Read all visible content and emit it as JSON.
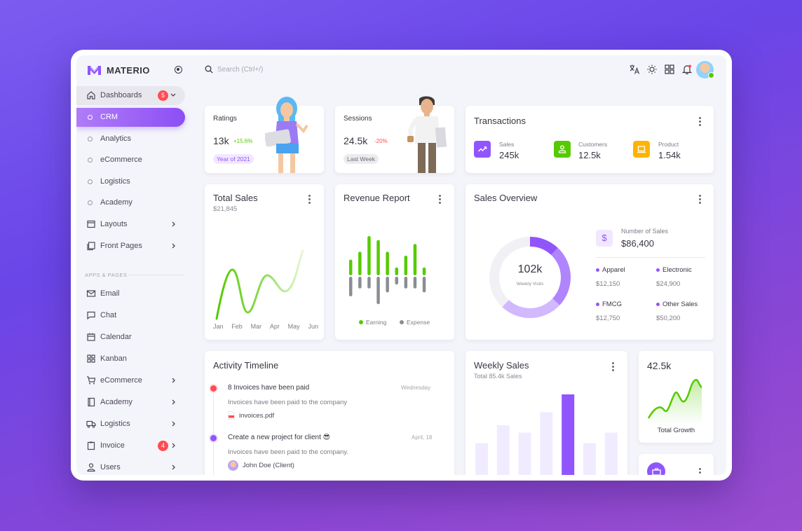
{
  "app": {
    "brand": "MATERIO"
  },
  "search": {
    "placeholder": "Search (Ctrl+/)"
  },
  "sidebar": {
    "dashboards": {
      "label": "Dashboards",
      "badge": "5"
    },
    "sub_items": [
      "CRM",
      "Analytics",
      "eCommerce",
      "Logistics",
      "Academy"
    ],
    "layouts": "Layouts",
    "front_pages": "Front Pages",
    "section": "APPS & PAGES",
    "apps": [
      {
        "label": "Email",
        "icon": "mail-icon"
      },
      {
        "label": "Chat",
        "icon": "chat-icon"
      },
      {
        "label": "Calendar",
        "icon": "calendar-icon"
      },
      {
        "label": "Kanban",
        "icon": "kanban-icon"
      },
      {
        "label": "eCommerce",
        "icon": "cart-icon"
      },
      {
        "label": "Academy",
        "icon": "book-icon"
      },
      {
        "label": "Logistics",
        "icon": "truck-icon"
      },
      {
        "label": "Invoice",
        "icon": "clipboard-icon",
        "badge": "4"
      },
      {
        "label": "Users",
        "icon": "user-icon"
      }
    ]
  },
  "ratings": {
    "title": "Ratings",
    "value": "13k",
    "change": "+15.6%",
    "tag": "Year of 2021"
  },
  "sessions": {
    "title": "Sessions",
    "value": "24.5k",
    "change": "-20%",
    "tag": "Last Week"
  },
  "transactions": {
    "title": "Transactions",
    "stats": [
      {
        "label": "Sales",
        "value": "245k",
        "color": "#9155fd",
        "icon": "trend-icon"
      },
      {
        "label": "Customers",
        "value": "12.5k",
        "color": "#56ca00",
        "icon": "user-icon"
      },
      {
        "label": "Product",
        "value": "1.54k",
        "color": "#ffb400",
        "icon": "laptop-icon"
      }
    ]
  },
  "total_sales": {
    "title": "Total Sales",
    "amount": "$21,845",
    "months": [
      "Jan",
      "Feb",
      "Mar",
      "Apr",
      "May",
      "Jun"
    ]
  },
  "revenue_report": {
    "title": "Revenue Report",
    "legend_earning": "Earning",
    "legend_expense": "Expense",
    "earning_color": "#56ca00",
    "expense_color": "#8a8d93"
  },
  "sales_overview": {
    "title": "Sales Overview",
    "center_value": "102k",
    "center_label": "Weekly Visits",
    "number_label": "Number of Sales",
    "number_value": "$86,400",
    "items": [
      {
        "name": "Apparel",
        "value": "$12,150"
      },
      {
        "name": "Electronic",
        "value": "$24,900"
      },
      {
        "name": "FMCG",
        "value": "$12,750"
      },
      {
        "name": "Other Sales",
        "value": "$50,200"
      }
    ]
  },
  "activity": {
    "title": "Activity Timeline",
    "items": [
      {
        "title": "8 Invoices have been paid",
        "date": "Wednesday",
        "desc": "Invoices have been paid to the company",
        "attachment": "invoices.pdf"
      },
      {
        "title": "Create a new project for client 😎",
        "date": "April, 18",
        "desc": "Invoices have been paid to the company.",
        "person": "John Doe (Client)"
      }
    ]
  },
  "weekly_sales": {
    "title": "Weekly Sales",
    "subtitle": "Total 85.4k Sales"
  },
  "growth": {
    "value": "42.5k",
    "label": "Total Growth"
  },
  "chart_data": [
    {
      "type": "bar",
      "title": "Revenue Report",
      "series": [
        {
          "name": "Earning",
          "values": [
            4,
            6,
            10,
            9,
            6,
            2,
            5,
            8,
            2
          ]
        },
        {
          "name": "Expense",
          "values": [
            5,
            3,
            3,
            7,
            4,
            2,
            3,
            3,
            4
          ]
        }
      ]
    },
    {
      "type": "pie",
      "title": "Sales Overview",
      "values": [
        12,
        25,
        25,
        38
      ]
    },
    {
      "type": "bar",
      "title": "Weekly Sales",
      "values": [
        40,
        62,
        53,
        78,
        100,
        40,
        53
      ]
    }
  ]
}
